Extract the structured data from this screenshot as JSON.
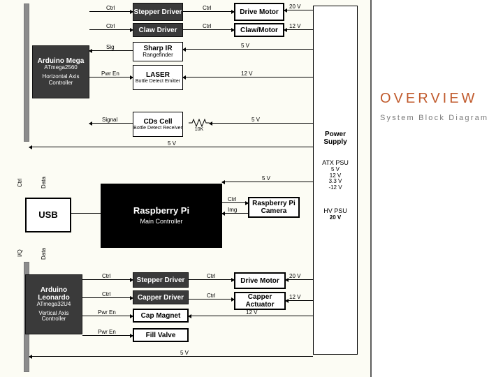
{
  "sidebar": {
    "title": "OVERVIEW",
    "subtitle": "System Block Diagram"
  },
  "blocks": {
    "mega": {
      "title": "Arduino Mega",
      "sub1": "ATmega2560",
      "sub2": "Horizontal Axis Controller"
    },
    "leo": {
      "title": "Arduino Leonardo",
      "sub1": "ATmega32U4",
      "sub2": "Vertical Axis Controller"
    },
    "usb": {
      "title": "USB"
    },
    "pi": {
      "title": "Raspberry Pi",
      "sub1": "Main Controller"
    },
    "picam": {
      "title": "Raspberry Pi Camera"
    },
    "psu": {
      "title": "Power Supply",
      "atx_title": "ATX PSU",
      "atx_lines": [
        "5 V",
        "12 V",
        "3.3 V",
        "-12 V"
      ],
      "hv_title": "HV PSU",
      "hv_line": "20 V"
    },
    "stepper1": "Stepper Driver",
    "claw": "Claw Driver",
    "sharp": {
      "t1": "Sharp IR",
      "t2": "Rangefinder"
    },
    "laser": {
      "t1": "LASER",
      "t2": "Bottle Detect Emitter"
    },
    "cds": {
      "t1": "CDs Cell",
      "t2": "Bottle Detect Receiver"
    },
    "drive1": "Drive Motor",
    "clawm": "Claw/Motor",
    "stepper2": "Stepper Driver",
    "capdrv": "Capper Driver",
    "capmag": "Cap Magnet",
    "fill": "Fill Valve",
    "drive2": "Drive Motor",
    "capact": "Capper Actuator"
  },
  "signals": {
    "ctrl": "Ctrl",
    "sig": "Sig",
    "pwren": "Pwr En",
    "signal": "Signal",
    "data": "Data",
    "iq": "I/Q",
    "img": "Img"
  },
  "volts": {
    "v5": "5 V",
    "v12": "12 V",
    "v20": "20 V"
  },
  "resistor": "10K"
}
